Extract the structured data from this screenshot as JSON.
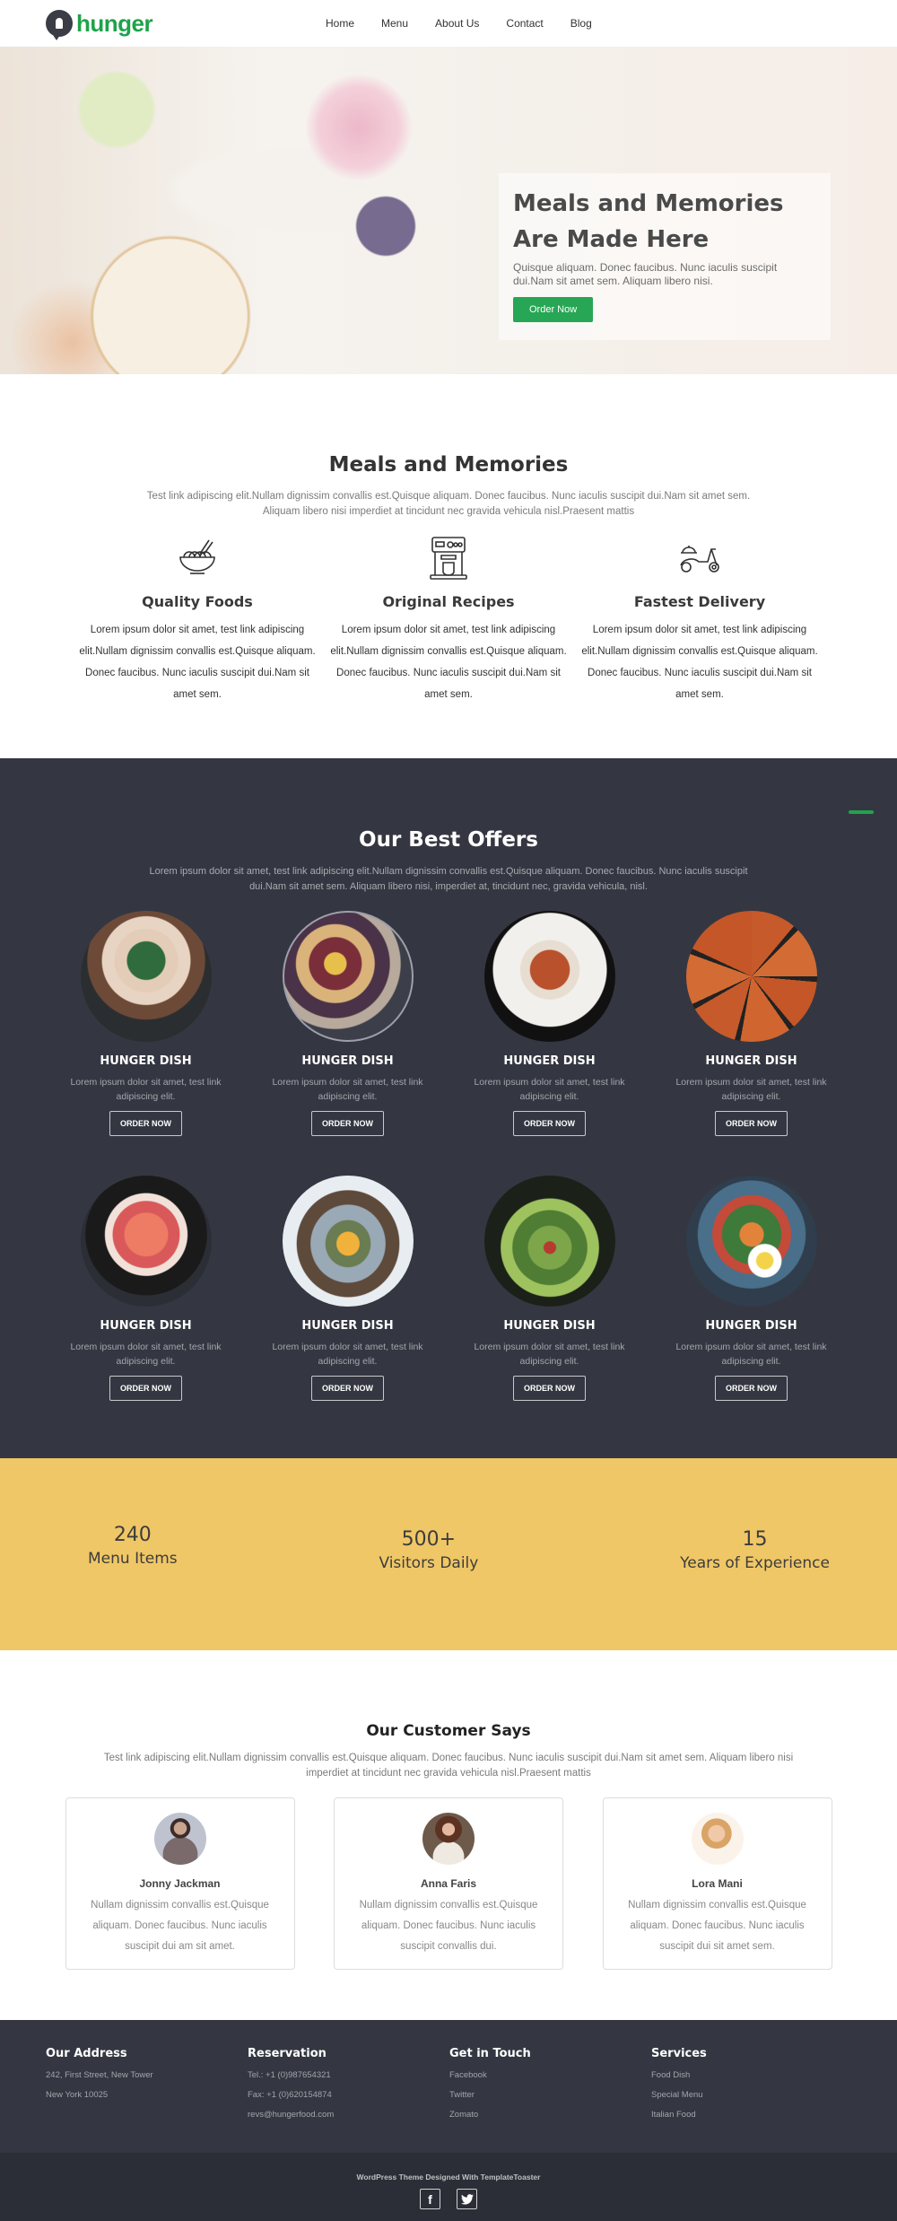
{
  "header": {
    "logo_text": "hunger",
    "nav": [
      "Home",
      "Menu",
      "About Us",
      "Contact",
      "Blog"
    ]
  },
  "hero": {
    "title": "Meals and Memories Are Made Here",
    "subtitle": "Quisque aliquam. Donec faucibus. Nunc iaculis suscipit dui.Nam sit amet sem. Aliquam libero nisi.",
    "button": "Order Now",
    "slides": 3,
    "active_slide": 2
  },
  "features": {
    "title": "Meals and Memories",
    "description": "Test link adipiscing elit.Nullam dignissim convallis est.Quisque aliquam. Donec faucibus. Nunc iaculis suscipit dui.Nam sit amet sem. Aliquam libero nisi imperdiet at tincidunt nec gravida vehicula nisl.Praesent mattis",
    "items": [
      {
        "icon": "noodle-bowl-icon",
        "title": "Quality Foods",
        "text": "Lorem ipsum dolor sit amet, test link adipiscing elit.Nullam dignissim convallis est.Quisque aliquam. Donec faucibus. Nunc iaculis suscipit dui.Nam sit amet sem."
      },
      {
        "icon": "coffee-machine-icon",
        "title": "Original Recipes",
        "text": "Lorem ipsum dolor sit amet, test link adipiscing elit.Nullam dignissim convallis est.Quisque aliquam. Donec faucibus. Nunc iaculis suscipit dui.Nam sit amet sem."
      },
      {
        "icon": "delivery-scooter-icon",
        "title": "Fastest Delivery",
        "text": "Lorem ipsum dolor sit amet, test link adipiscing elit.Nullam dignissim convallis est.Quisque aliquam. Donec faucibus. Nunc iaculis suscipit dui.Nam sit amet sem."
      }
    ]
  },
  "offers": {
    "title": "Our Best Offers",
    "description": "Lorem ipsum dolor sit amet, test link adipiscing elit.Nullam dignissim convallis est.Quisque aliquam. Donec faucibus. Nunc iaculis suscipit dui.Nam sit amet sem. Aliquam libero nisi, imperdiet at, tincidunt nec, gravida vehicula, nisl.",
    "dishes": [
      {
        "title": "HUNGER DISH",
        "text": "Lorem ipsum dolor sit amet, test link adipiscing elit.",
        "button": "ORDER NOW",
        "image": "layered-cake"
      },
      {
        "title": "HUNGER DISH",
        "text": "Lorem ipsum dolor sit amet, test link adipiscing elit.",
        "button": "ORDER NOW",
        "image": "fruit-platter"
      },
      {
        "title": "HUNGER DISH",
        "text": "Lorem ipsum dolor sit amet, test link adipiscing elit.",
        "button": "ORDER NOW",
        "image": "spaghetti-plate"
      },
      {
        "title": "HUNGER DISH",
        "text": "Lorem ipsum dolor sit amet, test link adipiscing elit.",
        "button": "ORDER NOW",
        "image": "pizza"
      },
      {
        "title": "HUNGER DISH",
        "text": "Lorem ipsum dolor sit amet, test link adipiscing elit.",
        "button": "ORDER NOW",
        "image": "salmon-bowl"
      },
      {
        "title": "HUNGER DISH",
        "text": "Lorem ipsum dolor sit amet, test link adipiscing elit.",
        "button": "ORDER NOW",
        "image": "grilled-fish"
      },
      {
        "title": "HUNGER DISH",
        "text": "Lorem ipsum dolor sit amet, test link adipiscing elit.",
        "button": "ORDER NOW",
        "image": "green-salad"
      },
      {
        "title": "HUNGER DISH",
        "text": "Lorem ipsum dolor sit amet, test link adipiscing elit.",
        "button": "ORDER NOW",
        "image": "veggie-egg-bowl"
      }
    ]
  },
  "stats": [
    {
      "value": "240",
      "label": "Menu Items"
    },
    {
      "value": "500+",
      "label": "Visitors Daily"
    },
    {
      "value": "15",
      "label": "Years of Experience"
    }
  ],
  "testimonials": {
    "title": "Our Customer Says",
    "description": "Test link adipiscing elit.Nullam dignissim convallis est.Quisque aliquam. Donec faucibus. Nunc iaculis suscipit dui.Nam sit amet sem. Aliquam libero nisi imperdiet at tincidunt nec gravida vehicula nisl.Praesent mattis",
    "items": [
      {
        "name": "Jonny Jackman",
        "text": "Nullam dignissim convallis est.Quisque aliquam. Donec faucibus. Nunc iaculis suscipit dui am sit amet."
      },
      {
        "name": "Anna Faris",
        "text": "Nullam dignissim convallis est.Quisque aliquam. Donec faucibus. Nunc iaculis suscipit convallis dui."
      },
      {
        "name": "Lora Mani",
        "text": "Nullam dignissim convallis est.Quisque aliquam. Donec faucibus. Nunc iaculis suscipit dui sit amet sem."
      }
    ]
  },
  "footer": {
    "columns": [
      {
        "title": "Our Address",
        "lines": [
          "242, First Street, New Tower",
          "New York 10025"
        ]
      },
      {
        "title": "Reservation",
        "lines": [
          "Tel.: +1 (0)987654321",
          "Fax: +1 (0)620154874",
          "revs@hungerfood.com"
        ]
      },
      {
        "title": "Get in Touch",
        "lines": [
          "Facebook",
          "Twitter",
          "Zomato"
        ]
      },
      {
        "title": "Services",
        "lines": [
          "Food Dish",
          "Special Menu",
          "Italian Food"
        ]
      }
    ],
    "credit": "WordPress Theme Designed With TemplateToaster",
    "social": [
      {
        "icon": "facebook-icon",
        "glyph": "f"
      },
      {
        "icon": "twitter-icon",
        "glyph": "t"
      }
    ]
  },
  "colors": {
    "brand_green": "#22a24b",
    "dark_bg": "#343741",
    "stats_yellow": "#f0c766"
  }
}
